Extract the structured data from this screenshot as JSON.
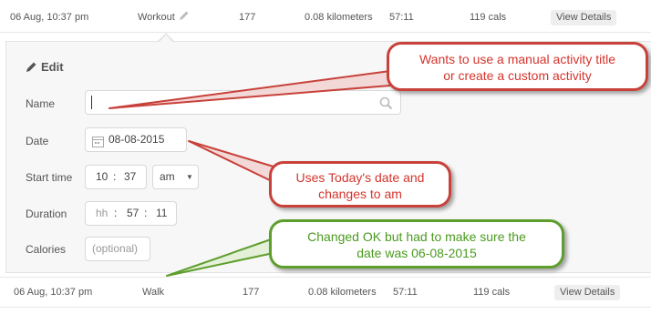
{
  "top_row": {
    "datetime": "06 Aug, 10:37 pm",
    "activity": "Workout",
    "steps": "177",
    "distance": "0.08 kilometers",
    "duration": "57:11",
    "calories": "119 cals",
    "view_details": "View Details"
  },
  "edit_form": {
    "title": "Edit",
    "name_label": "Name",
    "name_value": "",
    "date_label": "Date",
    "date_value": "08-08-2015",
    "start_label": "Start time",
    "start_hour": "10",
    "start_minute": "37",
    "start_ampm": "am",
    "duration_label": "Duration",
    "duration_hh_placeholder": "hh",
    "duration_minutes": "57",
    "duration_seconds": "11",
    "calories_label": "Calories",
    "calories_placeholder": "(optional)"
  },
  "bottom_row": {
    "datetime": "06 Aug, 10:37 pm",
    "activity": "Walk",
    "steps": "177",
    "distance": "0.08 kilometers",
    "duration": "57:11",
    "calories": "119 cals",
    "view_details": "View Details"
  },
  "annotations": {
    "name_note_line1": "Wants to use a manual activity title",
    "name_note_line2": "or create a custom activity",
    "date_note_line1": "Uses Today's date and",
    "date_note_line2": "changes to am",
    "ok_note_line1": "Changed OK but had to make sure the",
    "ok_note_line2": "date was 06-08-2015"
  },
  "colors": {
    "red_callout": "#c8413a",
    "green_callout": "#5e9e2d",
    "panel_bg": "#f7f7f7"
  }
}
